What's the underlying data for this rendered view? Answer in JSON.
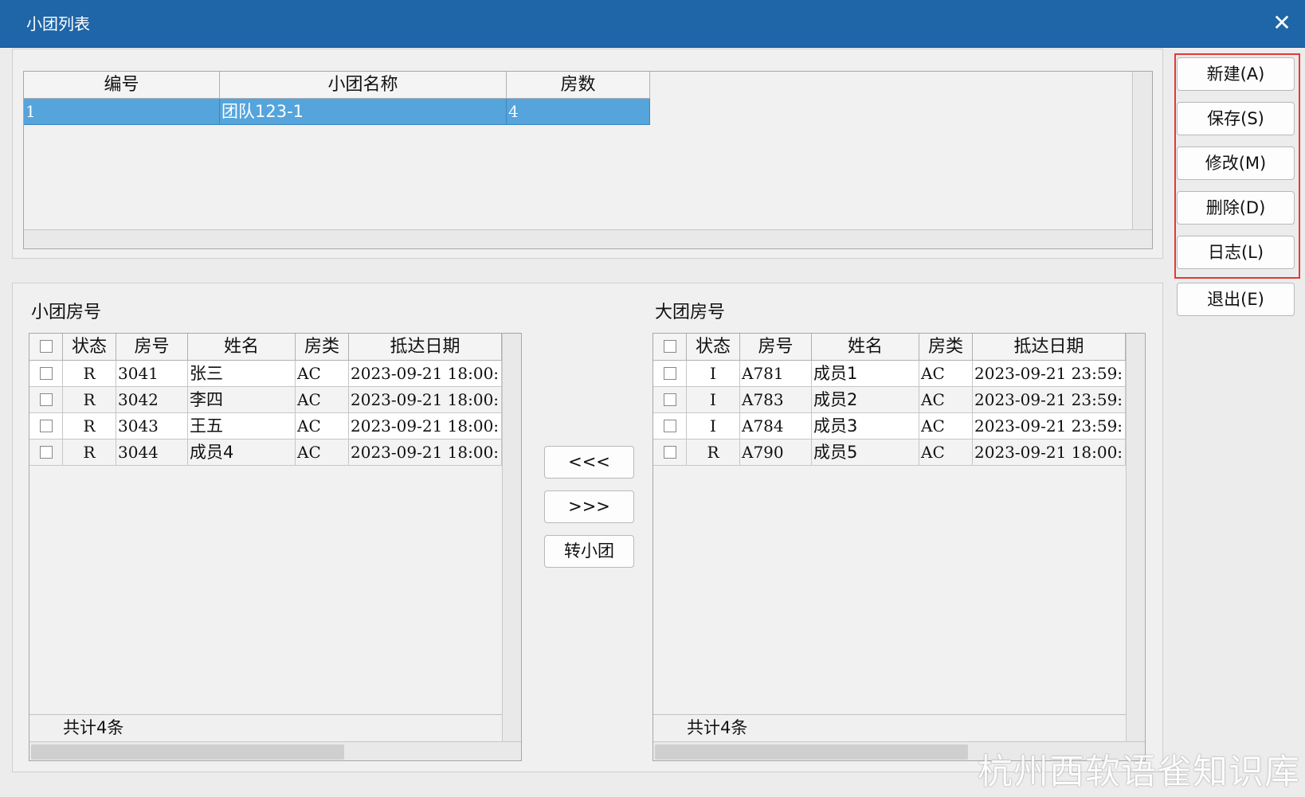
{
  "window": {
    "title": "小团列表",
    "close_glyph": "✕"
  },
  "subgroup_list": {
    "columns": [
      "编号",
      "小团名称",
      "房数"
    ],
    "rows": [
      {
        "id": "1",
        "name": "团队123-1",
        "rooms": "4"
      }
    ]
  },
  "sidebar": {
    "buttons": [
      "新建(A)",
      "保存(S)",
      "修改(M)",
      "删除(D)",
      "日志(L)",
      "退出(E)"
    ],
    "highlight_color": "#e53935"
  },
  "small_group": {
    "title": "小团房号",
    "columns": [
      "状态",
      "房号",
      "姓名",
      "房类",
      "抵达日期"
    ],
    "rows": [
      {
        "status": "R",
        "room": "3041",
        "name": "张三",
        "type": "AC",
        "arrival": "2023-09-21 18:00:"
      },
      {
        "status": "R",
        "room": "3042",
        "name": "李四",
        "type": "AC",
        "arrival": "2023-09-21 18:00:"
      },
      {
        "status": "R",
        "room": "3043",
        "name": "王五",
        "type": "AC",
        "arrival": "2023-09-21 18:00:"
      },
      {
        "status": "R",
        "room": "3044",
        "name": "成员4",
        "type": "AC",
        "arrival": "2023-09-21 18:00:"
      }
    ],
    "footer": "共计4条"
  },
  "transfer": {
    "to_small": "<<<",
    "to_big": ">>>",
    "convert": "转小团"
  },
  "big_group": {
    "title": "大团房号",
    "columns": [
      "状态",
      "房号",
      "姓名",
      "房类",
      "抵达日期"
    ],
    "rows": [
      {
        "status": "I",
        "room": "A781",
        "name": "成员1",
        "type": "AC",
        "arrival": "2023-09-21 23:59:"
      },
      {
        "status": "I",
        "room": "A783",
        "name": "成员2",
        "type": "AC",
        "arrival": "2023-09-21 23:59:"
      },
      {
        "status": "I",
        "room": "A784",
        "name": "成员3",
        "type": "AC",
        "arrival": "2023-09-21 23:59:"
      },
      {
        "status": "R",
        "room": "A790",
        "name": "成员5",
        "type": "AC",
        "arrival": "2023-09-21 18:00:"
      }
    ],
    "footer": "共计4条"
  },
  "watermark": "杭州西软语雀知识库",
  "colors": {
    "titlebar": "#1f66a8",
    "selection": "#55a4dc"
  }
}
